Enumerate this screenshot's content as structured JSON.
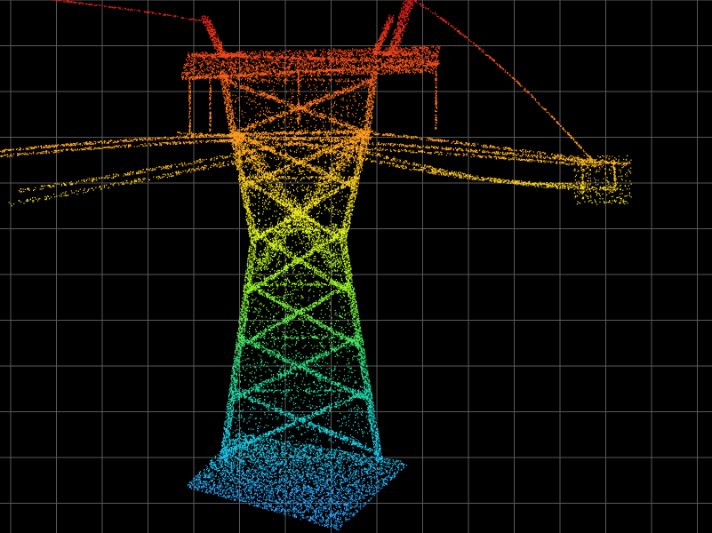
{
  "viewer": {
    "background_color": "#000000",
    "grid_color": "#5a5a5a",
    "grid_visible": true,
    "colormap": "height",
    "colormap_stops": [
      "#2aa8ff",
      "#19d6e0",
      "#2de07a",
      "#8ef02a",
      "#e8f020",
      "#ffb020",
      "#ff6a1a",
      "#e0201a"
    ]
  },
  "scene": {
    "object": "transmission-tower-point-cloud",
    "parts": [
      "ground-plane",
      "tower-legs",
      "tower-waist",
      "crossarm",
      "left-peak",
      "right-peak",
      "hangers",
      "conductors-left",
      "conductors-right",
      "distant-insulator-cluster"
    ]
  }
}
